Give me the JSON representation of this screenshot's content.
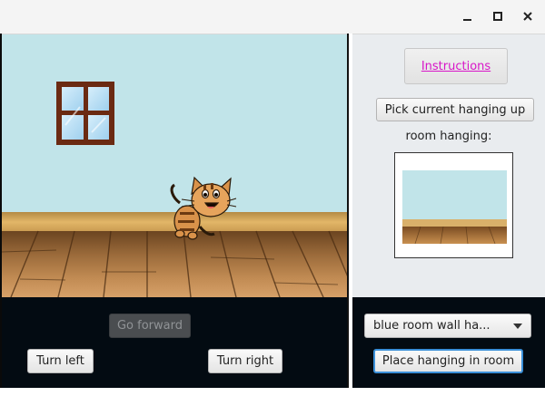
{
  "window": {
    "controls": {
      "minimize_icon": "minimize-icon",
      "maximize_icon": "maximize-icon",
      "close_icon": "close-icon"
    }
  },
  "scene": {
    "wall_color": "#c1e4e9",
    "floor_color": "#9a6a3a",
    "window_frame_color": "#6b2a12",
    "icons": [
      "window-icon",
      "cat-icon"
    ]
  },
  "controls": {
    "go_forward": "Go forward",
    "go_forward_enabled": false,
    "turn_left": "Turn left",
    "turn_right": "Turn right"
  },
  "sidebar": {
    "instructions_label": "Instructions",
    "pick_label": "Pick current hanging up",
    "room_hanging_label": "room hanging:",
    "hanging_select_value": "blue room wall ha...",
    "place_label": "Place hanging in room",
    "link_color": "#d815c8",
    "focus_color": "#3a8fd8"
  }
}
